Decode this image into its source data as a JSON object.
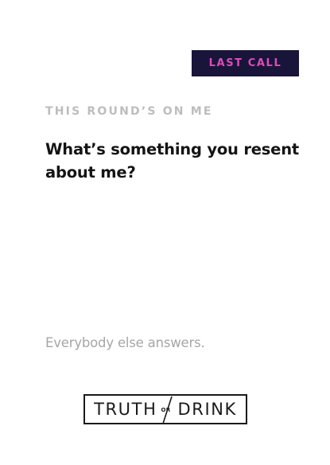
{
  "card": {
    "badge": "LAST CALL",
    "eyebrow": "THIS ROUND’S ON ME",
    "question": "What’s something you resent about me?",
    "instruction": "Everybody else answers.",
    "logo": {
      "left_word": "TRUTH",
      "connector": "OR",
      "right_word": "DRINK"
    }
  },
  "colors": {
    "badge_background": "#19143a",
    "badge_text": "#e04bb6",
    "eyebrow_text": "#bdbdbd",
    "question_text": "#141414",
    "instruction_text": "#a6a6a6"
  }
}
